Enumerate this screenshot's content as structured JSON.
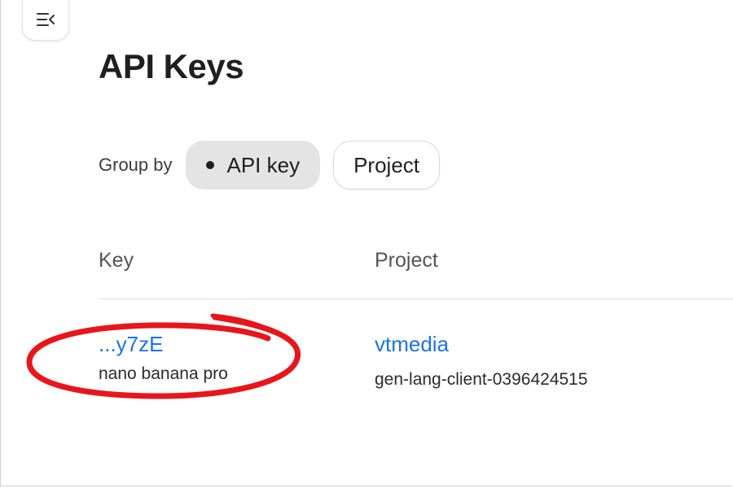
{
  "toolbar": {
    "collapse_icon": "collapse-sidebar-icon"
  },
  "page": {
    "title": "API Keys"
  },
  "group_by": {
    "label": "Group by",
    "options": [
      {
        "label": "API key",
        "selected": true
      },
      {
        "label": "Project",
        "selected": false
      }
    ]
  },
  "table": {
    "headers": {
      "key": "Key",
      "project": "Project"
    },
    "rows": [
      {
        "key": "...y7zE",
        "key_name": "nano banana pro",
        "project": "vtmedia",
        "project_id": "gen-lang-client-0396424515"
      }
    ]
  },
  "annotation": {
    "color": "#e8161b",
    "shape": "hand-drawn-ellipse"
  },
  "colors": {
    "link": "#1a73e8",
    "chip_selected_bg": "#e4e4e4"
  }
}
